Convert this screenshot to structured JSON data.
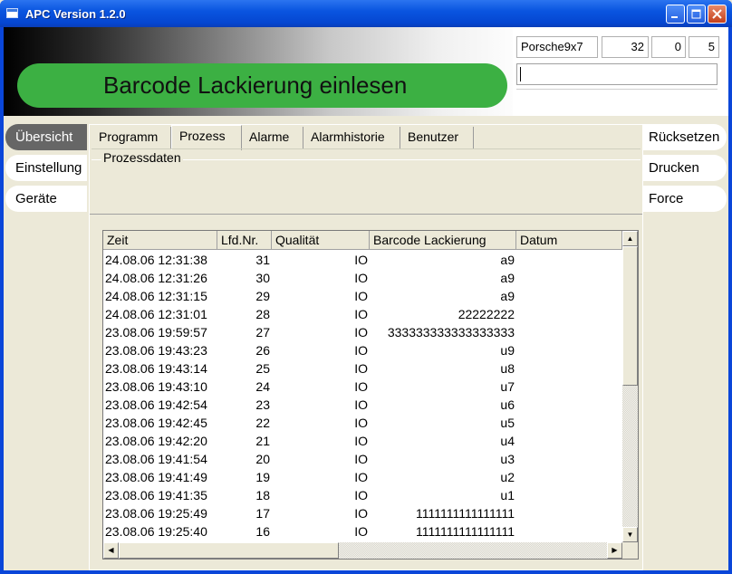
{
  "window": {
    "title": "APC Version 1.2.0"
  },
  "header": {
    "banner": "Barcode Lackierung einlesen",
    "model": "Porsche9x7",
    "counter_a": "32",
    "counter_b": "0",
    "counter_c": "5",
    "barcode_input_value": ""
  },
  "left_nav": [
    {
      "label": "Übersicht",
      "active": true
    },
    {
      "label": "Einstellung",
      "active": false
    },
    {
      "label": "Geräte",
      "active": false
    }
  ],
  "right_nav": [
    {
      "label": "Rücksetzen"
    },
    {
      "label": "Drucken"
    },
    {
      "label": "Force"
    }
  ],
  "tabs": [
    {
      "label": "Programm",
      "active": false
    },
    {
      "label": "Prozess",
      "active": true
    },
    {
      "label": "Alarme",
      "active": false
    },
    {
      "label": "Alarmhistorie",
      "active": false
    },
    {
      "label": "Benutzer",
      "active": false
    }
  ],
  "group_title": "Prozessdaten",
  "table": {
    "columns": [
      "Zeit",
      "Lfd.Nr.",
      "Qualität",
      "Barcode Lackierung",
      "Datum"
    ],
    "rows": [
      [
        "24.08.06 12:31:38",
        "31",
        "IO",
        "a9"
      ],
      [
        "24.08.06 12:31:26",
        "30",
        "IO",
        "a9"
      ],
      [
        "24.08.06 12:31:15",
        "29",
        "IO",
        "a9"
      ],
      [
        "24.08.06 12:31:01",
        "28",
        "IO",
        "22222222"
      ],
      [
        "23.08.06 19:59:57",
        "27",
        "IO",
        "333333333333333333"
      ],
      [
        "23.08.06 19:43:23",
        "26",
        "IO",
        "u9"
      ],
      [
        "23.08.06 19:43:14",
        "25",
        "IO",
        "u8"
      ],
      [
        "23.08.06 19:43:10",
        "24",
        "IO",
        "u7"
      ],
      [
        "23.08.06 19:42:54",
        "23",
        "IO",
        "u6"
      ],
      [
        "23.08.06 19:42:45",
        "22",
        "IO",
        "u5"
      ],
      [
        "23.08.06 19:42:20",
        "21",
        "IO",
        "u4"
      ],
      [
        "23.08.06 19:41:54",
        "20",
        "IO",
        "u3"
      ],
      [
        "23.08.06 19:41:49",
        "19",
        "IO",
        "u2"
      ],
      [
        "23.08.06 19:41:35",
        "18",
        "IO",
        "u1"
      ],
      [
        "23.08.06 19:25:49",
        "17",
        "IO",
        "1111111111111111"
      ],
      [
        "23.08.06 19:25:40",
        "16",
        "IO",
        "1111111111111111"
      ]
    ]
  },
  "colors": {
    "banner": "#3cb043",
    "titlebar": "#0a55e0",
    "active_nav": "#666666"
  }
}
